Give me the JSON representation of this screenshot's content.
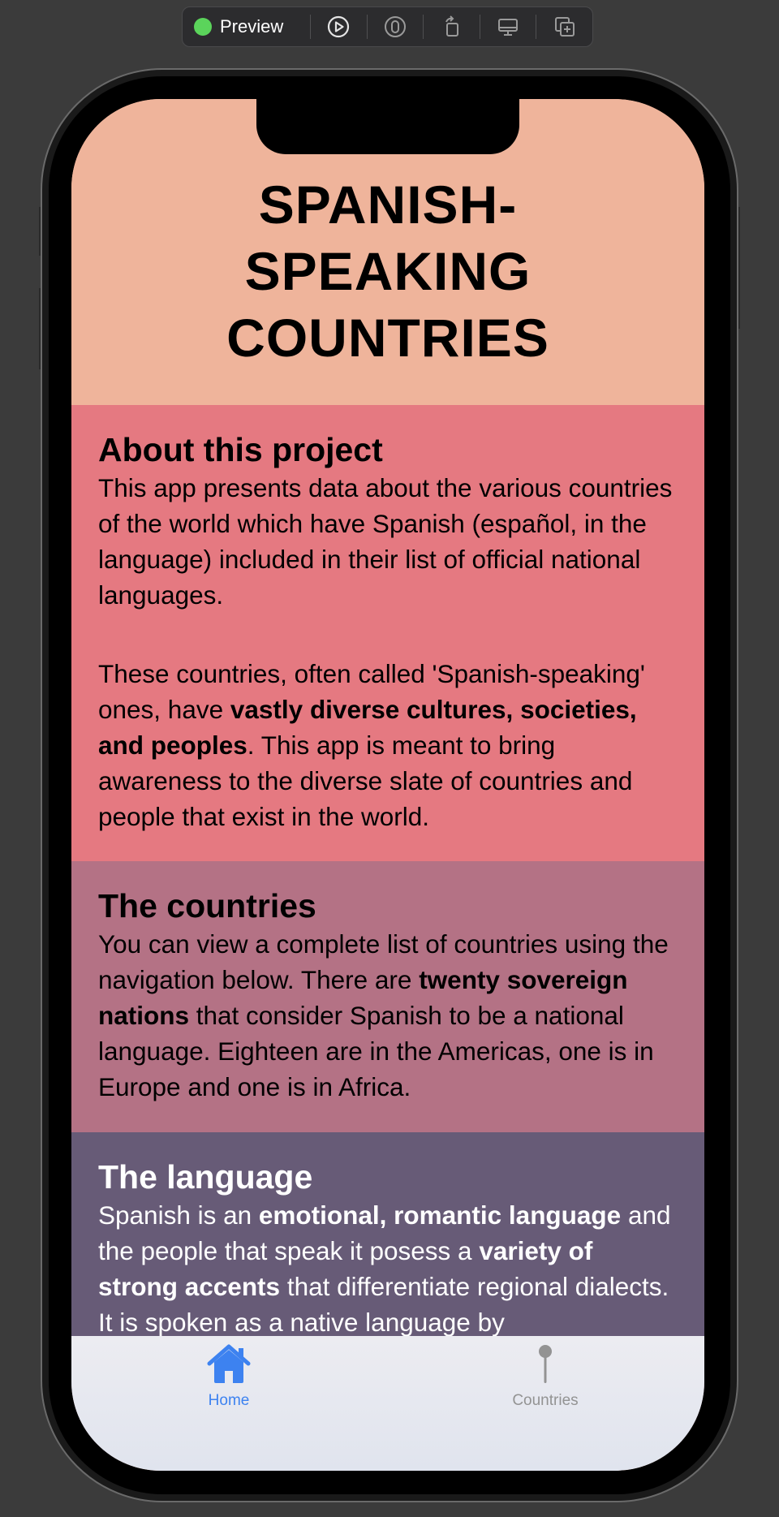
{
  "toolbar": {
    "preview_label": "Preview",
    "buttons": [
      "play-icon",
      "select-icon",
      "rotate-icon",
      "device-icon",
      "duplicate-icon"
    ]
  },
  "header": {
    "title": "SPANISH-SPEAKING COUNTRIES"
  },
  "about": {
    "heading": "About this project",
    "p1": "This app presents data about the various countries of the world which have Spanish (español, in the language) included in their list of official national languages.",
    "p2_a": "These countries, often called 'Spanish-speaking' ones, have ",
    "p2_bold": "vastly diverse cultures, societies, and peoples",
    "p2_b": ". This app is meant to bring awareness to the diverse slate of countries and people that exist in the world."
  },
  "countries": {
    "heading": "The countries",
    "p_a": "You can view a complete list of countries using the navigation below. There are ",
    "p_bold": "twenty sovereign nations",
    "p_b": " that consider Spanish to be a national language. Eighteen are in the Americas, one is in Europe and one is in Africa."
  },
  "language": {
    "heading": "The language",
    "p_a": "Spanish is an ",
    "p_bold1": "emotional, romantic language",
    "p_b": " and the people that speak it posess a ",
    "p_bold2": "variety of strong accents",
    "p_c": " that differentiate regional dialects. It is spoken as a native language by"
  },
  "tabbar": {
    "tabs": [
      {
        "label": "Home",
        "icon": "house-icon",
        "selected": true
      },
      {
        "label": "Countries",
        "icon": "pin-icon",
        "selected": false
      }
    ]
  },
  "colors": {
    "header_bg": "#efb49b",
    "about_bg": "#e57981",
    "countries_bg": "#b47285",
    "language_bg": "#675b77",
    "tab_selected": "#3d82f0",
    "tab_unselected": "#939393"
  }
}
